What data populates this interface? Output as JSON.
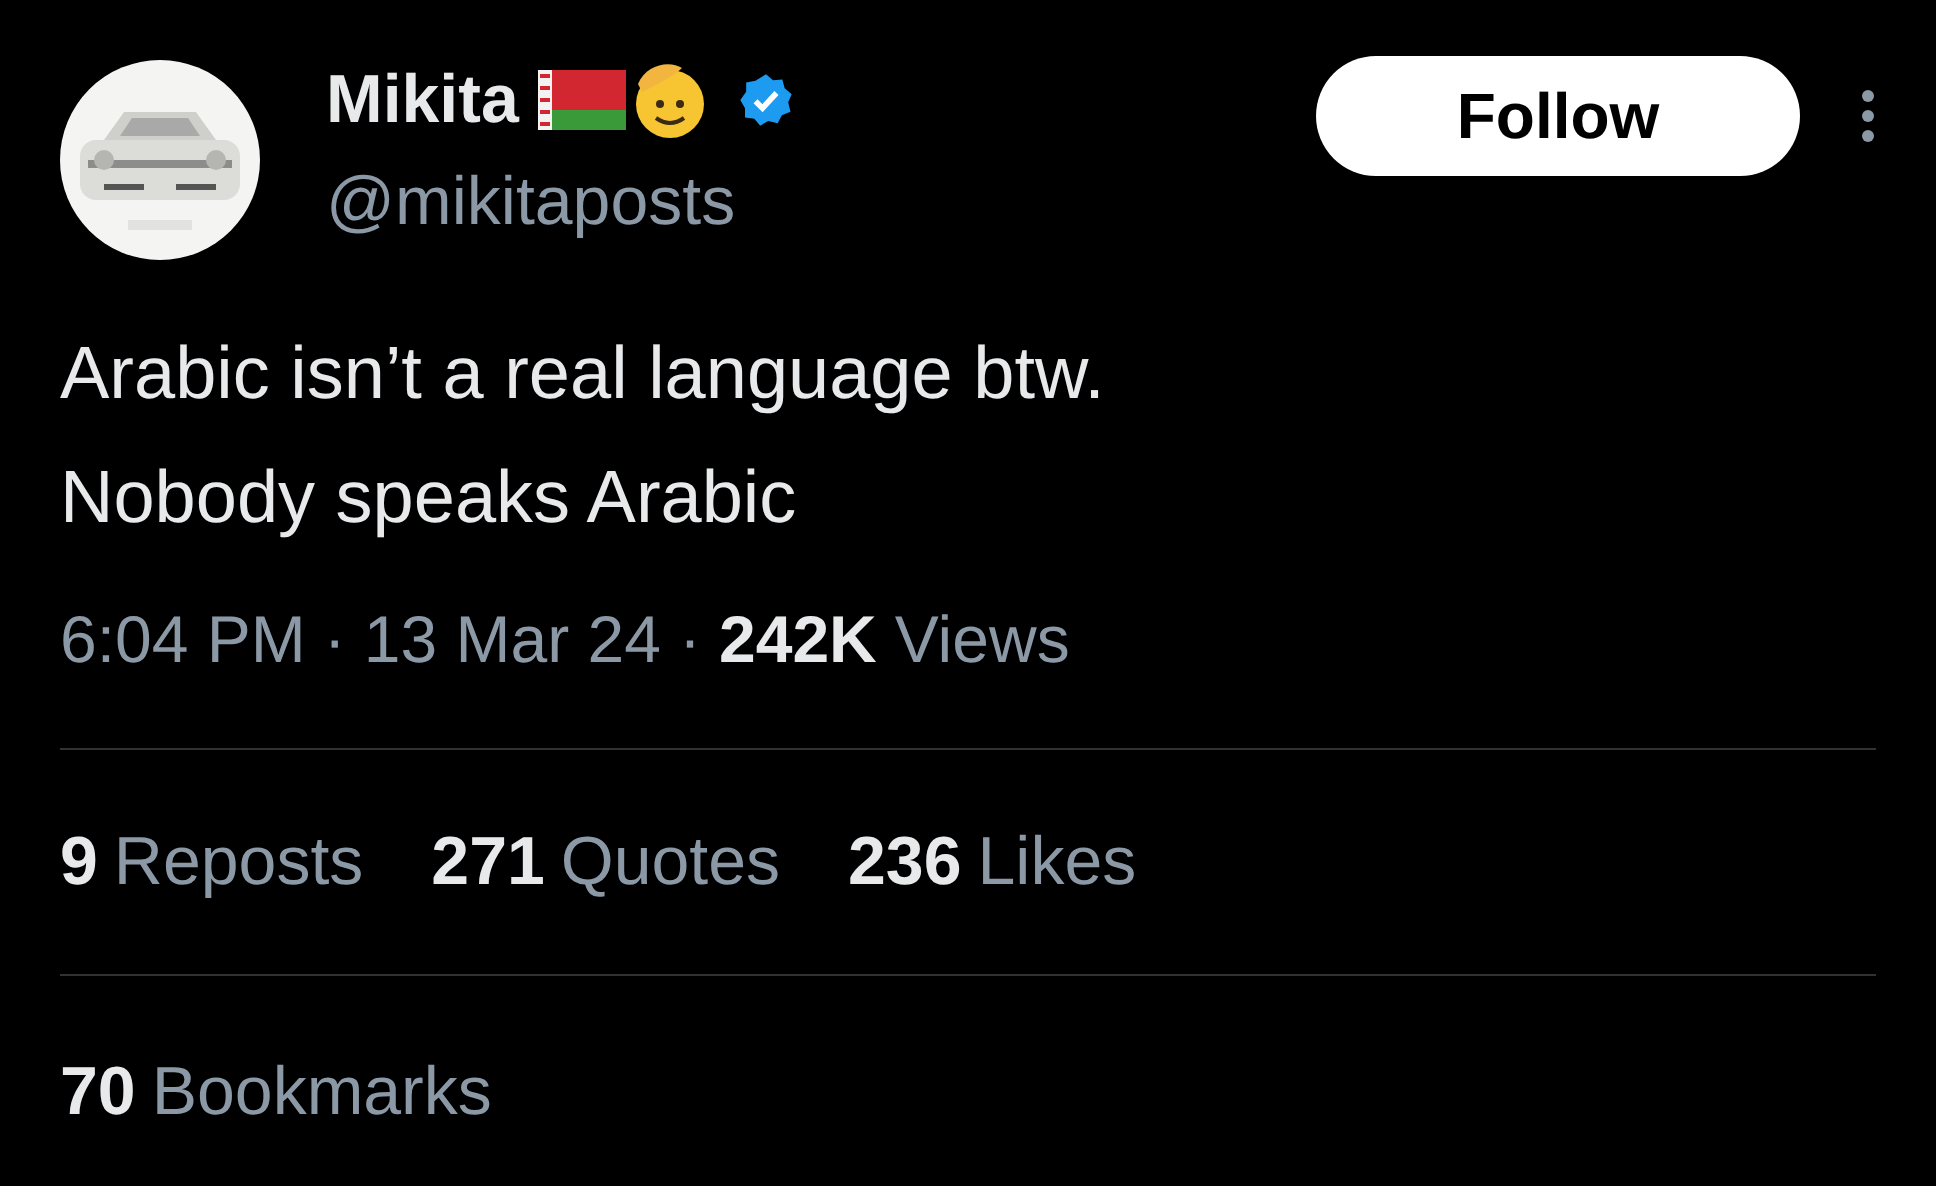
{
  "author": {
    "name": "Mikita",
    "handle": "@mikitaposts",
    "verified": true
  },
  "follow_button": "Follow",
  "tweet_lines": [
    "Arabic isn’t a real language btw.",
    "Nobody speaks Arabic"
  ],
  "meta": [
    {
      "kind": "plain",
      "text": "6:04 PM"
    },
    {
      "kind": "separator",
      "text": "·"
    },
    {
      "kind": "plain",
      "text": "13 Mar 24"
    },
    {
      "kind": "separator",
      "text": "·"
    },
    {
      "kind": "strong",
      "text": "242K"
    },
    {
      "kind": "plain",
      "text": "Views"
    }
  ],
  "stats": [
    {
      "count": "9",
      "label": "Reposts"
    },
    {
      "count": "271",
      "label": "Quotes"
    },
    {
      "count": "236",
      "label": "Likes"
    }
  ],
  "bookmarks": {
    "count": "70",
    "label": "Bookmarks"
  }
}
